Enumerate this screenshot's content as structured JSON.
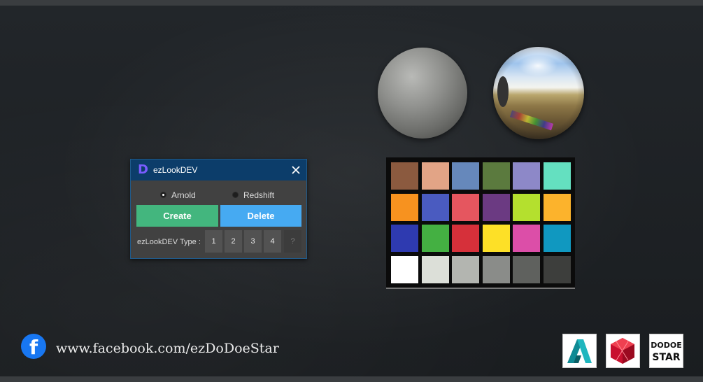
{
  "dialog": {
    "title": "ezLookDEV",
    "app_icon_letter": "D",
    "close_icon": "close-icon",
    "renderers": [
      {
        "label": "Arnold",
        "selected": true
      },
      {
        "label": "Redshift",
        "selected": false
      }
    ],
    "create_label": "Create",
    "delete_label": "Delete",
    "type_label": "ezLookDEV Type :",
    "type_buttons": [
      "1",
      "2",
      "3",
      "4"
    ],
    "help_label": "?"
  },
  "footer": {
    "facebook_icon": "facebook-icon",
    "facebook_url": "www.facebook.com/ezDoDoeStar",
    "dodoe_logo_lines": [
      "DODOE",
      "STAR"
    ]
  },
  "logos": [
    "maya-logo",
    "redshift-logo",
    "dodoe-star-logo"
  ],
  "color_checker": [
    [
      "#8b5a3f",
      "#e2a486",
      "#6688bb",
      "#5b7a3e",
      "#8d88c8",
      "#64e0c0"
    ],
    [
      "#f7921f",
      "#4a5bc0",
      "#e5565f",
      "#6b3a82",
      "#b4e02e",
      "#fcb32c"
    ],
    [
      "#2e3ab0",
      "#44b042",
      "#d6303a",
      "#fde027",
      "#dc4ea8",
      "#1098c0"
    ],
    [
      "#ffffff",
      "#dcdfd8",
      "#b3b5b0",
      "#8a8c89",
      "#5f615e",
      "#3d3e3c"
    ]
  ],
  "colors": {
    "title_bar": "#0c3d6a",
    "create_button": "#43b67e",
    "delete_button": "#46aaf2",
    "dialog_bg": "#414141"
  }
}
